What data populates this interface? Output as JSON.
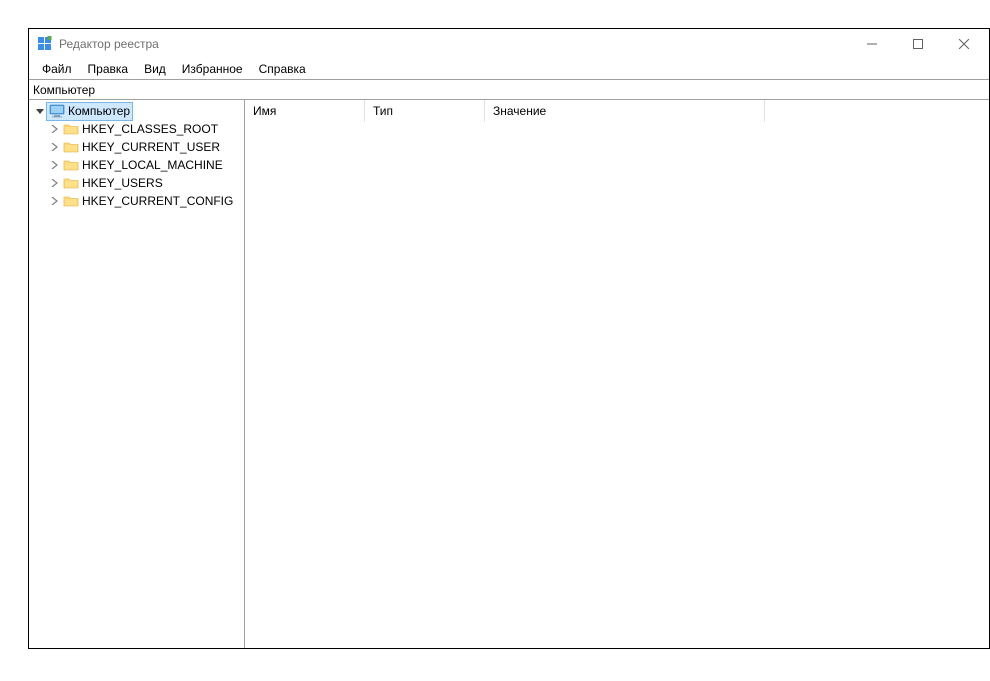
{
  "window": {
    "title": "Редактор реестра"
  },
  "menu": {
    "file": "Файл",
    "edit": "Правка",
    "view": "Вид",
    "favorites": "Избранное",
    "help": "Справка"
  },
  "address": {
    "path": "Компьютер"
  },
  "tree": {
    "root": {
      "label": "Компьютер",
      "expanded": true,
      "children": [
        {
          "label": "HKEY_CLASSES_ROOT"
        },
        {
          "label": "HKEY_CURRENT_USER"
        },
        {
          "label": "HKEY_LOCAL_MACHINE"
        },
        {
          "label": "HKEY_USERS"
        },
        {
          "label": "HKEY_CURRENT_CONFIG"
        }
      ]
    }
  },
  "columns": {
    "name": "Имя",
    "type": "Тип",
    "value": "Значение"
  }
}
